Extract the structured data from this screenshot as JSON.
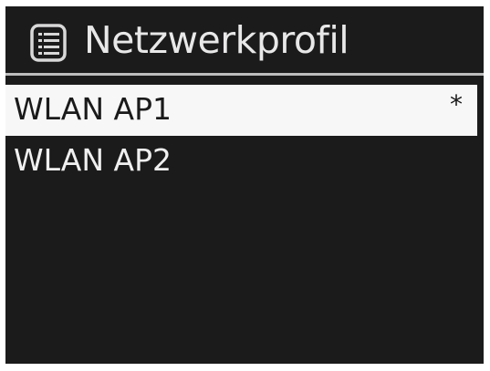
{
  "header": {
    "icon": "list-menu-icon",
    "title": "Netzwerkprofil"
  },
  "list": {
    "items": [
      {
        "label": "WLAN AP1",
        "marker": "*",
        "selected": true
      },
      {
        "label": "WLAN AP2",
        "marker": "",
        "selected": false
      }
    ]
  },
  "colors": {
    "screen_background": "#1c1b1c",
    "text": "#e8e8e8",
    "selection_background": "#f7f7f7",
    "selection_text": "#1a1a1a",
    "divider": "#bdbdbd"
  }
}
